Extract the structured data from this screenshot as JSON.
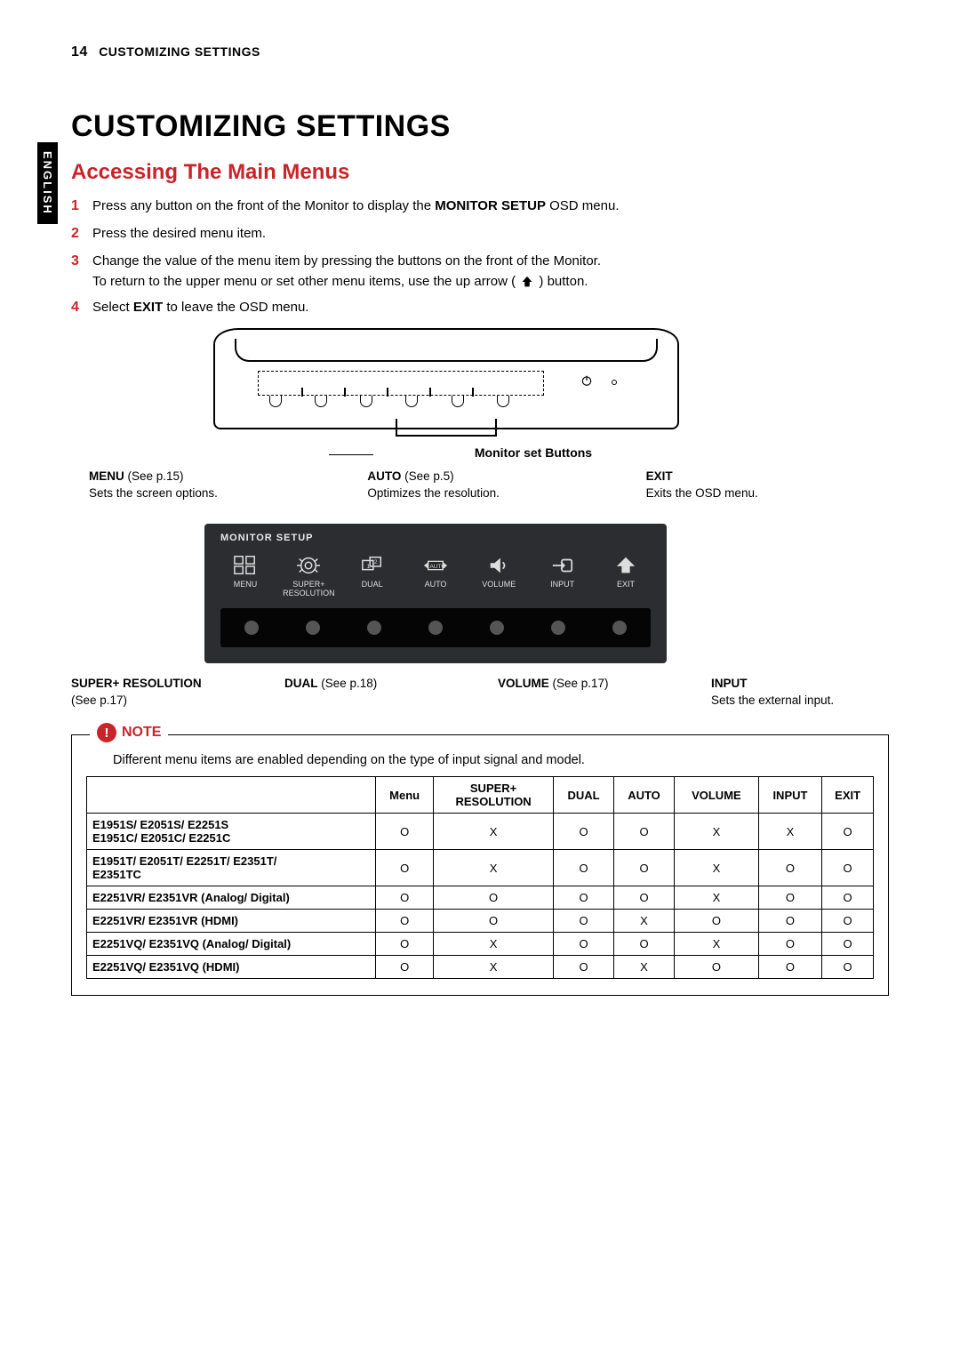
{
  "page_number": "14",
  "running_head": "CUSTOMIZING SETTINGS",
  "side_tab": "ENGLISH",
  "title": "CUSTOMIZING SETTINGS",
  "subtitle": "Accessing The Main Menus",
  "steps": [
    {
      "n": "1",
      "before": "Press any button on the front of the Monitor to display the ",
      "bold": "MONITOR SETUP",
      "after": " OSD menu."
    },
    {
      "n": "2",
      "before": "Press the desired menu item.",
      "bold": "",
      "after": ""
    },
    {
      "n": "3",
      "before": "Change the value of the menu item by pressing the buttons on the front of the Monitor.\nTo return to the upper menu or set other menu items, use the up arrow ( ",
      "bold": "",
      "after": " ) button.",
      "icon": true
    },
    {
      "n": "4",
      "before": "Select ",
      "bold": "EXIT",
      "after": " to leave the OSD menu."
    }
  ],
  "figure_caption": "Monitor set Buttons",
  "callouts_top": [
    {
      "head": "MENU",
      "tail": " (See p.15)",
      "desc": "Sets the screen options."
    },
    {
      "head": "AUTO",
      "tail": " (See p.5)",
      "desc": "Optimizes the resolution."
    },
    {
      "head": "EXIT",
      "tail": "",
      "desc": "Exits the OSD menu."
    }
  ],
  "callouts_bottom": [
    {
      "head": "SUPER+ RESOLUTION",
      "tail": "",
      "desc": "(See p.17)"
    },
    {
      "head": "DUAL",
      "tail": " (See p.18)",
      "desc": ""
    },
    {
      "head": "VOLUME",
      "tail": " (See p.17)",
      "desc": ""
    },
    {
      "head": "INPUT",
      "tail": "",
      "desc": "Sets the external input."
    }
  ],
  "osd": {
    "title": "MONITOR SETUP",
    "items": [
      "MENU",
      "SUPER+\nRESOLUTION",
      "DUAL",
      "AUTO",
      "VOLUME",
      "INPUT",
      "EXIT"
    ]
  },
  "note": {
    "label": "NOTE",
    "text": "Different menu items are enabled depending on the type of input signal and model.",
    "columns": [
      "Menu",
      "SUPER+\nRESOLUTION",
      "DUAL",
      "AUTO",
      "VOLUME",
      "INPUT",
      "EXIT"
    ],
    "rows": [
      {
        "model": "E1951S/ E2051S/ E2251S\nE1951C/ E2051C/ E2251C",
        "v": [
          "O",
          "X",
          "O",
          "O",
          "X",
          "X",
          "O"
        ]
      },
      {
        "model": "E1951T/ E2051T/ E2251T/ E2351T/\nE2351TC",
        "v": [
          "O",
          "X",
          "O",
          "O",
          "X",
          "O",
          "O"
        ]
      },
      {
        "model": "E2251VR/ E2351VR (Analog/ Digital)",
        "v": [
          "O",
          "O",
          "O",
          "O",
          "X",
          "O",
          "O"
        ]
      },
      {
        "model": "E2251VR/ E2351VR (HDMI)",
        "v": [
          "O",
          "O",
          "O",
          "X",
          "O",
          "O",
          "O"
        ]
      },
      {
        "model": "E2251VQ/ E2351VQ (Analog/ Digital)",
        "v": [
          "O",
          "X",
          "O",
          "O",
          "X",
          "O",
          "O"
        ]
      },
      {
        "model": "E2251VQ/ E2351VQ (HDMI)",
        "v": [
          "O",
          "X",
          "O",
          "X",
          "O",
          "O",
          "O"
        ]
      }
    ]
  }
}
